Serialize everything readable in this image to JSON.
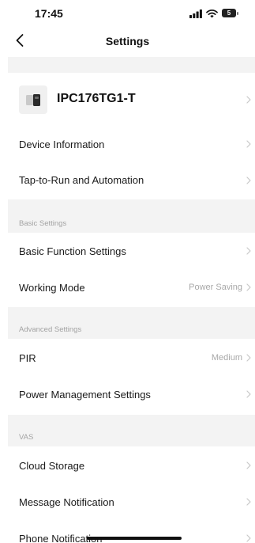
{
  "status_bar": {
    "time": "17:45",
    "battery_level": "5",
    "icons": [
      "signal-icon",
      "wifi-icon",
      "battery-icon"
    ]
  },
  "nav": {
    "title": "Settings",
    "back_icon": "chevron-left-icon"
  },
  "device": {
    "name": "IPC176TG1-T",
    "thumbnail_icon": "camera-icon"
  },
  "general_items": [
    {
      "label": "Device Information"
    },
    {
      "label": "Tap-to-Run and Automation"
    }
  ],
  "basic_settings": {
    "header": "Basic Settings",
    "items": [
      {
        "label": "Basic Function Settings",
        "value": ""
      },
      {
        "label": "Working Mode",
        "value": "Power Saving"
      }
    ]
  },
  "advanced_settings": {
    "header": "Advanced Settings",
    "items": [
      {
        "label": "PIR",
        "value": "Medium"
      },
      {
        "label": "Power Management Settings",
        "value": ""
      }
    ]
  },
  "vas": {
    "header": "VAS",
    "items": [
      {
        "label": "Cloud Storage"
      },
      {
        "label": "Message Notification"
      },
      {
        "label": "Phone Notification"
      }
    ]
  },
  "colors": {
    "background": "#ffffff",
    "section_background": "#f3f3f3",
    "secondary_text": "#a3a3a3",
    "chevron": "#c8c8c8"
  }
}
